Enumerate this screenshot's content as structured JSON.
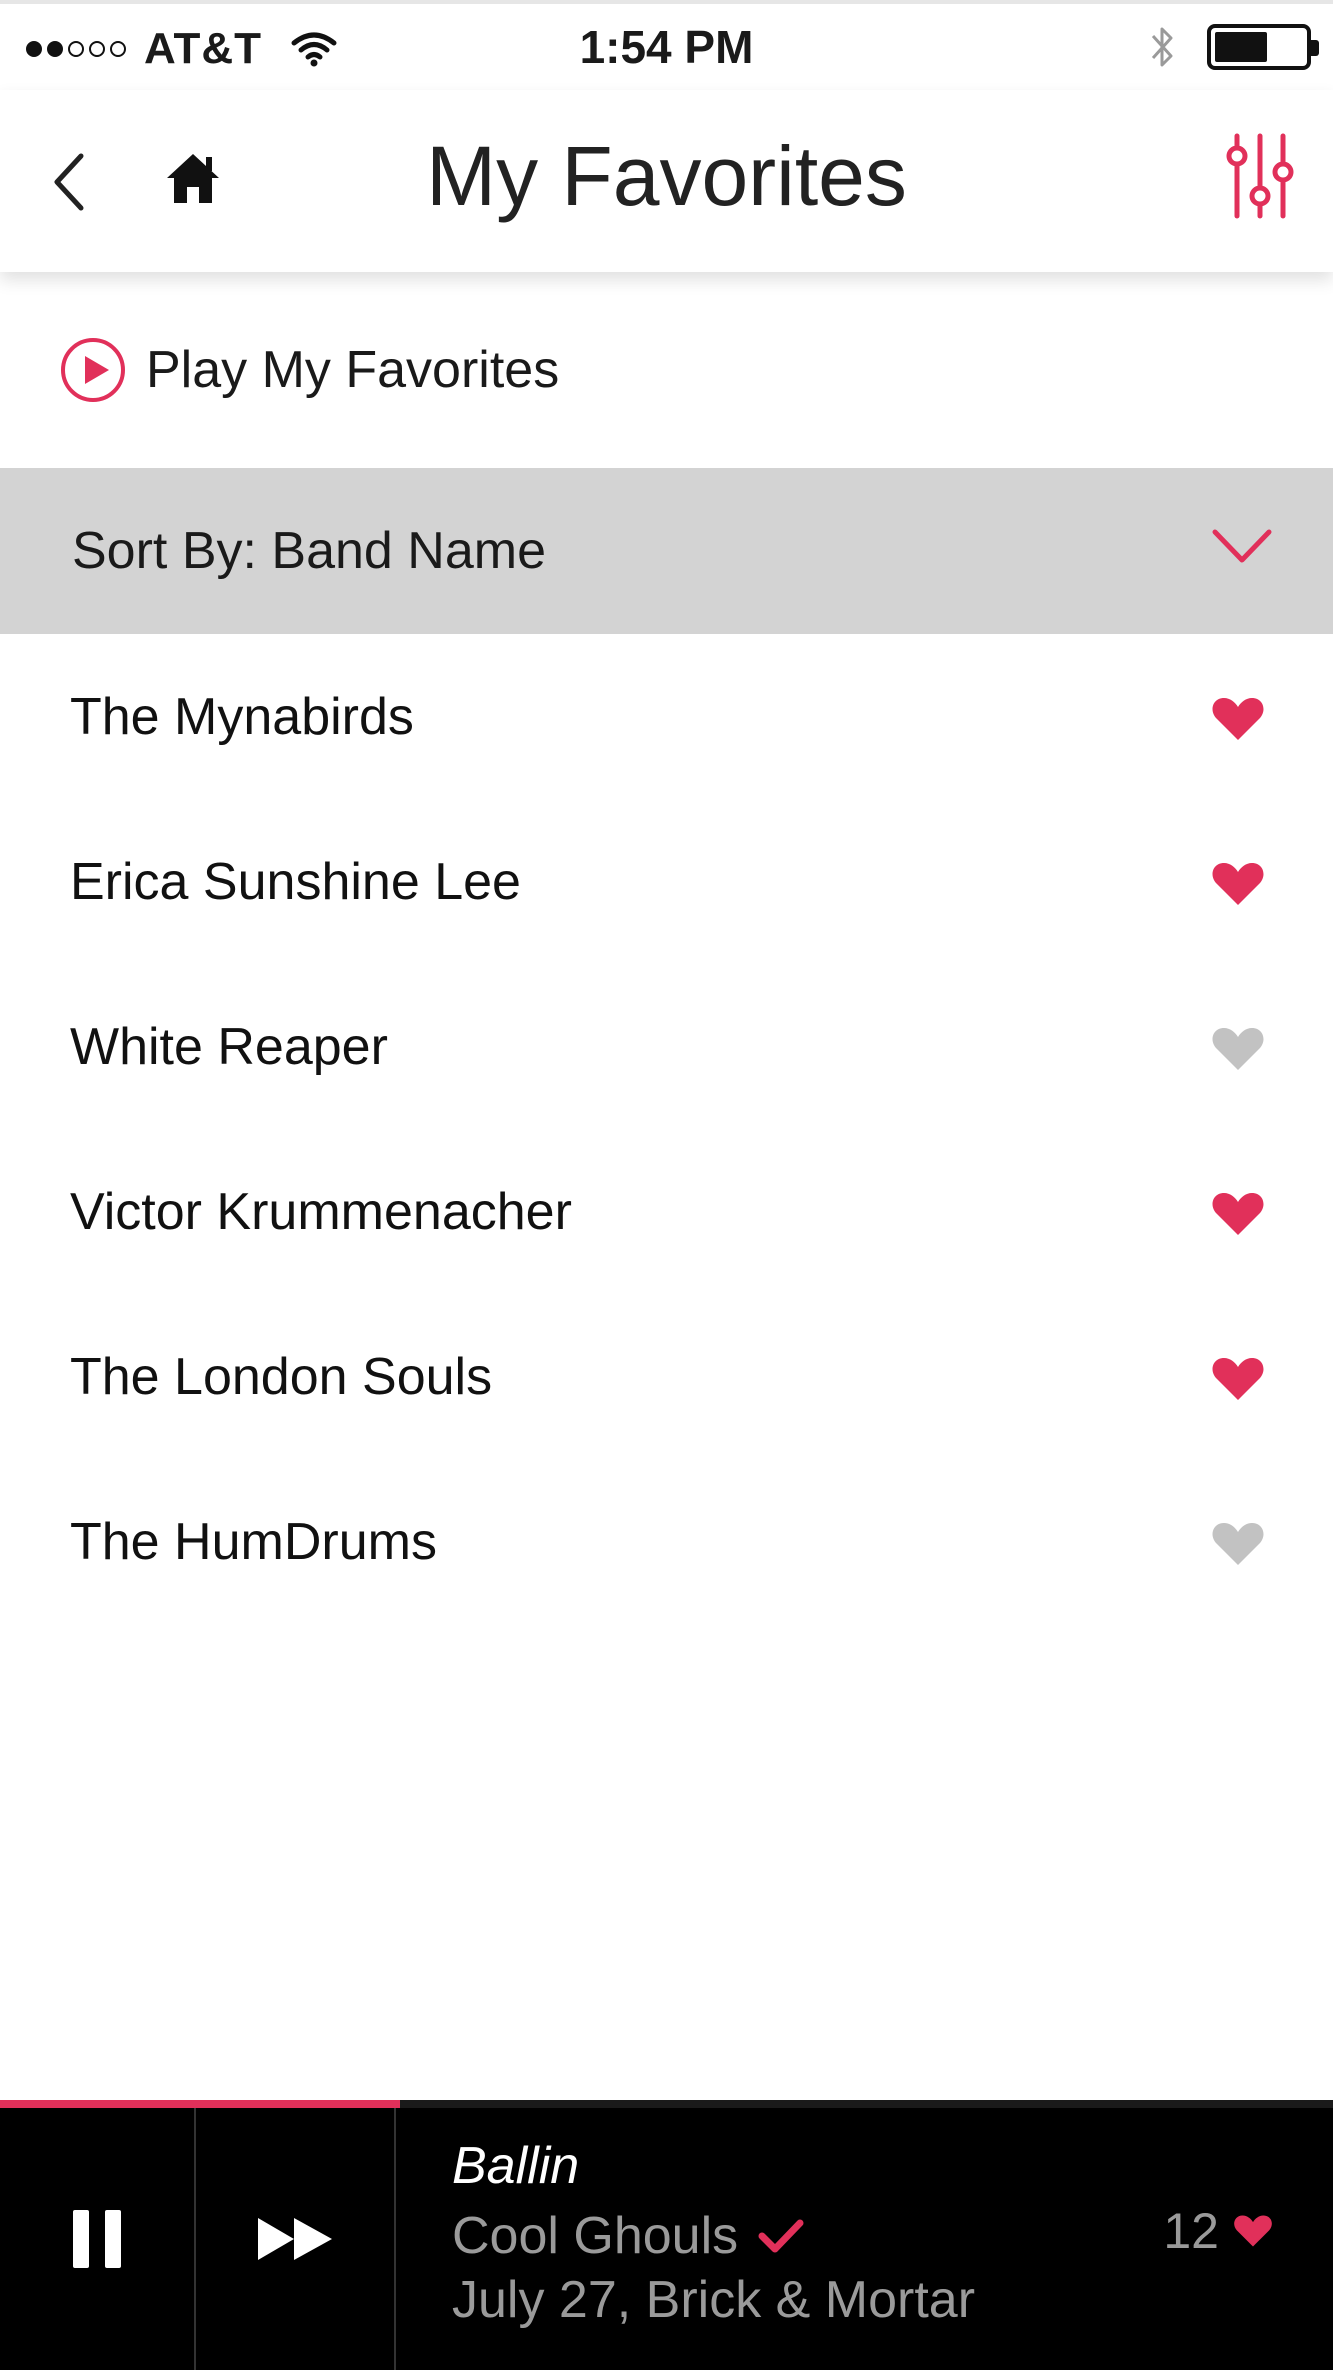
{
  "status_bar": {
    "carrier": "AT&T",
    "time": "1:54 PM",
    "signal_bars_filled": 2,
    "signal_bars_total": 5,
    "battery_level": 0.5
  },
  "header": {
    "title": "My Favorites",
    "back_icon": "chevron-left-icon",
    "home_icon": "home-icon",
    "filter_icon": "sliders-icon"
  },
  "play_favorites": {
    "label": "Play My Favorites",
    "icon": "play-circle-icon"
  },
  "sort": {
    "label": "Sort By: Band Name",
    "icon": "chevron-down-icon"
  },
  "bands": [
    {
      "name": "The Mynabirds",
      "favorited": true
    },
    {
      "name": "Erica Sunshine Lee",
      "favorited": true
    },
    {
      "name": "White Reaper",
      "favorited": false
    },
    {
      "name": "Victor Krummenacher",
      "favorited": true
    },
    {
      "name": "The London Souls",
      "favorited": true
    },
    {
      "name": "The HumDrums",
      "favorited": false
    }
  ],
  "player": {
    "progress": 0.3,
    "track_title": "Ballin",
    "band": "Cool Ghouls",
    "event": "July 27, Brick & Mortar",
    "like_count": "12",
    "pause_icon": "pause-icon",
    "next_icon": "fast-forward-icon",
    "check_icon": "checkmark-icon"
  },
  "colors": {
    "accent": "#e1305a",
    "heart_inactive": "#c2c2c2",
    "sort_bar_bg": "#d3d3d3",
    "player_bg": "#000000",
    "player_secondary_text": "#9a9a9a"
  }
}
